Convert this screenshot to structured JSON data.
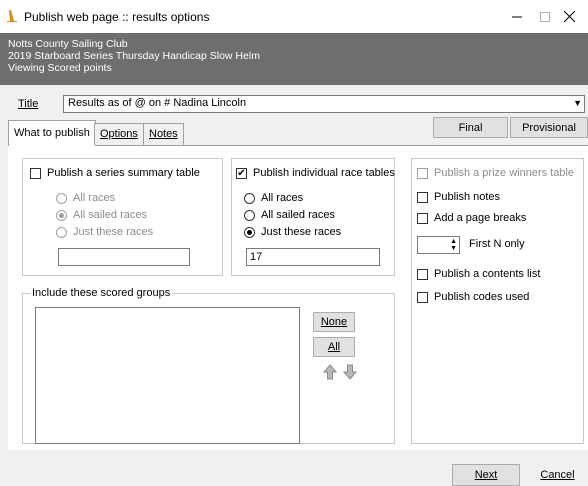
{
  "window": {
    "title": "Publish web page :: results options",
    "min_icon": "minimize-icon",
    "max_icon": "maximize-icon",
    "close_icon": "close-icon"
  },
  "header": {
    "line1": "Notts County Sailing Club",
    "line2": "2019 Starboard Series Thursday Handicap Slow Helm",
    "line3": "Viewing Scored points"
  },
  "title_field": {
    "label": "Title",
    "value": "Results as of @ on # Nadina Lincoln"
  },
  "tabs": [
    {
      "label": "What to publish",
      "active": true
    },
    {
      "label": "Options",
      "active": false
    },
    {
      "label": "Notes",
      "active": false
    }
  ],
  "buttons": {
    "final": "Final",
    "provisional": "Provisional",
    "none": "None",
    "all": "All",
    "next": "Next",
    "cancel": "Cancel"
  },
  "series_summary": {
    "label": "Publish a series summary table",
    "checked": false,
    "options": [
      "All races",
      "All sailed races",
      "Just these races"
    ],
    "selected": "All sailed races",
    "races_value": ""
  },
  "race_tables": {
    "label": "Publish individual race tables",
    "checked": true,
    "options": [
      "All races",
      "All sailed races",
      "Just these races"
    ],
    "selected": "Just these races",
    "races_value": "17"
  },
  "groups": {
    "legend": "Include these scored groups",
    "items": []
  },
  "right_options": {
    "prize_winners": "Publish a prize winners table",
    "notes": "Publish notes",
    "page_breaks": "Add a page breaks",
    "first_n_label": "First N only",
    "first_n_value": "",
    "contents_list": "Publish a contents list",
    "codes_used": "Publish codes used"
  }
}
